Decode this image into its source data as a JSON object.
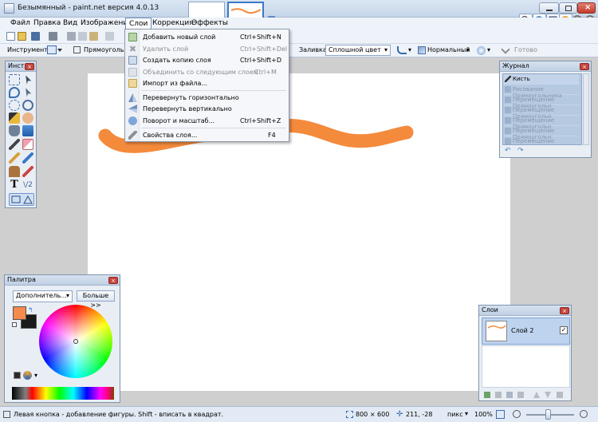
{
  "window": {
    "title": "Безымянный - paint.net версия 4.0.13"
  },
  "menubar": [
    "Файл",
    "Правка",
    "Вид",
    "Изображение",
    "Слои",
    "Коррекция",
    "Эффекты"
  ],
  "toolbar2": {
    "tool_label": "Инструмент:",
    "shape_label": "Прямоугольник",
    "fill_label": "Заливка:",
    "fill_value": "Сплошной цвет",
    "blend_value": "Нормальный",
    "finish_label": "Готово"
  },
  "layers_menu": {
    "items": [
      {
        "label": "Добавить новый слой",
        "shortcut": "Ctrl+Shift+N",
        "enabled": true
      },
      {
        "label": "Удалить слой",
        "shortcut": "Ctrl+Shift+Del",
        "enabled": false
      },
      {
        "label": "Создать копию слоя",
        "shortcut": "Ctrl+Shift+D",
        "enabled": true
      },
      {
        "label": "Объединить со следующим слоем",
        "shortcut": "Ctrl+M",
        "enabled": false
      },
      {
        "label": "Импорт из файла...",
        "shortcut": "",
        "enabled": true
      },
      {
        "label": "Перевернуть горизонтально",
        "shortcut": "",
        "enabled": true
      },
      {
        "label": "Перевернуть вертикально",
        "shortcut": "",
        "enabled": true
      },
      {
        "label": "Поворот и масштаб...",
        "shortcut": "Ctrl+Shift+Z",
        "enabled": true
      },
      {
        "label": "Свойства слоя...",
        "shortcut": "F4",
        "enabled": true
      }
    ]
  },
  "tools_panel": {
    "title": "Инст..."
  },
  "history_panel": {
    "title": "Журнал",
    "items": [
      "Кисть",
      "Рисование Прямоугольника",
      "Перемещение Прямоугольн",
      "Перемещение Прямоугольн",
      "Перемещение Прямоугольн",
      "Перемещение Прямоугольн",
      "Перемещение Прямоугольн"
    ]
  },
  "palette_panel": {
    "title": "Палитра",
    "mode": "Дополнитель...",
    "more_button": "Больше >>",
    "primary_color": "#f48a4c",
    "secondary_color": "#1a1a1a"
  },
  "layers_panel": {
    "title": "Слои",
    "layer_name": "Слой 2",
    "layer_visible": true
  },
  "status": {
    "hint": "Левая кнопка - добавление фигуры. Shift - вписать в квадрат.",
    "image_size": "800 × 600",
    "cursor": "211, -28",
    "units": "пикс",
    "zoom": "100%"
  },
  "colors": {
    "stroke": "#f48a3c",
    "accent": "#3a78c8"
  }
}
